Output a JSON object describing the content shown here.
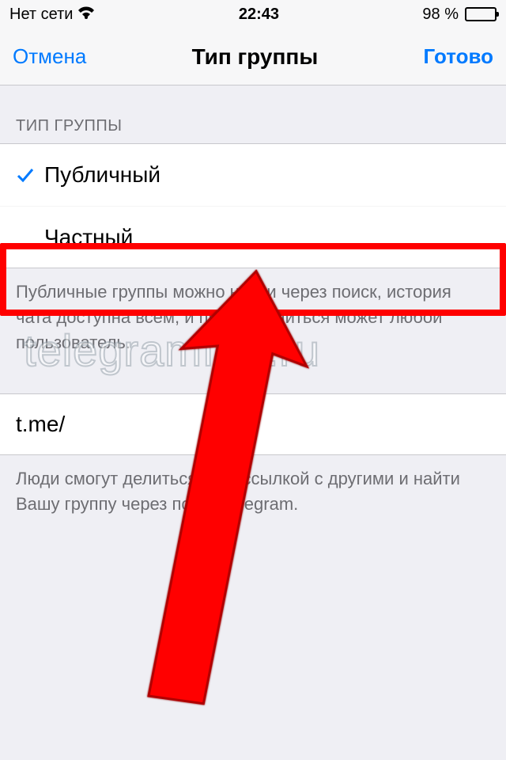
{
  "status": {
    "carrier": "Нет сети",
    "time": "22:43",
    "battery_pct": "98 %"
  },
  "nav": {
    "cancel": "Отмена",
    "title": "Тип группы",
    "done": "Готово"
  },
  "section": {
    "header": "ТИП ГРУППЫ",
    "options": {
      "public": "Публичный",
      "private": "Частный"
    },
    "footer": "Публичные группы можно найти через поиск, история чата доступна всем, и присоединиться может любой пользователь."
  },
  "link": {
    "prefix": "t.me/",
    "footer": "Люди смогут делиться этой ссылкой с другими и найти Вашу группу через поиск Telegram."
  },
  "watermark": "telegramfaq.ru"
}
